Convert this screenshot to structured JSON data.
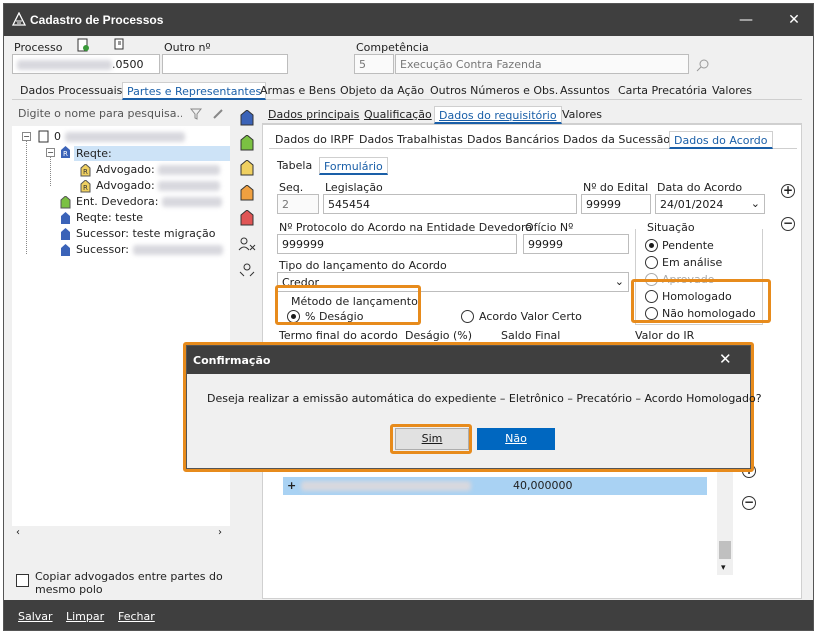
{
  "window": {
    "title": "Cadastro de Processos",
    "minimize": "—",
    "close": "✕"
  },
  "header": {
    "processo_label": "Processo",
    "processo_value_suffix": ".0500",
    "outro_label": "Outro nº",
    "outro_value": "",
    "competencia_label": "Competência",
    "competencia_num": "5",
    "competencia_text": "Execução Contra Fazenda"
  },
  "main_tabs": [
    "Dados Processuais",
    "Partes e Representantes",
    "Armas e Bens",
    "Objeto da Ação",
    "Outros Números e Obs.",
    "Assuntos",
    "Carta Precatória",
    "Valores"
  ],
  "left": {
    "search_placeholder": "Digite o nome para pesquisa...",
    "tree": [
      {
        "label": "0"
      },
      {
        "label": "Reqte:"
      },
      {
        "label": "Advogado:"
      },
      {
        "label": "Advogado:"
      },
      {
        "label": "Ent. Devedora:"
      },
      {
        "label": "Reqte: teste"
      },
      {
        "label": "Sucessor: teste  migração"
      },
      {
        "label": "Sucessor:"
      }
    ],
    "copy_checkbox_label": "Copiar advogados entre partes do mesmo polo"
  },
  "sub_tabs": [
    "Dados principais",
    "Qualificação",
    "Dados do requisitório",
    "Valores"
  ],
  "req_tabs": [
    "Dados do IRPF",
    "Dados Trabalhistas",
    "Dados Bancários",
    "Dados da Sucessão",
    "Dados do Acordo"
  ],
  "form_tabs": [
    "Tabela",
    "Formulário"
  ],
  "form": {
    "seq_label": "Seq.",
    "seq_value": "2",
    "legislacao_label": "Legislação",
    "legislacao_value": "545454",
    "edital_label": "Nº do Edital",
    "edital_value": "99999",
    "data_acordo_label": "Data do Acordo",
    "data_acordo_value": "24/01/2024",
    "protocolo_label": "Nº Protocolo do Acordo na Entidade Devedora",
    "protocolo_value": "999999",
    "oficio_label": "Ofício Nº",
    "oficio_value": "99999",
    "situacao_label": "Situação",
    "situacao_options": [
      "Pendente",
      "Em análise",
      "Aprovado",
      "Homologado",
      "Não homologado"
    ],
    "tipo_label": "Tipo do lançamento do Acordo",
    "tipo_value": "Credor",
    "metodo_label": "Método de lançamento",
    "metodo_desagio": "% Deságio",
    "metodo_certo": "Acordo Valor Certo",
    "termo_label": "Termo final do acordo",
    "desagio_label": "Deságio (%)",
    "saldo_label": "Saldo Final",
    "ir_label": "Valor do IR",
    "grid_row_value": "40,000000",
    "grid_row_expander": "+"
  },
  "dialog": {
    "title": "Confirmação",
    "message": "Deseja realizar a emissão automática do expediente – Eletrônico – Precatório – Acordo Homologado?",
    "yes": "Sim",
    "no": "Não",
    "close": "✕"
  },
  "bottom": {
    "save": "Salvar",
    "clear": "Limpar",
    "close": "Fechar"
  }
}
